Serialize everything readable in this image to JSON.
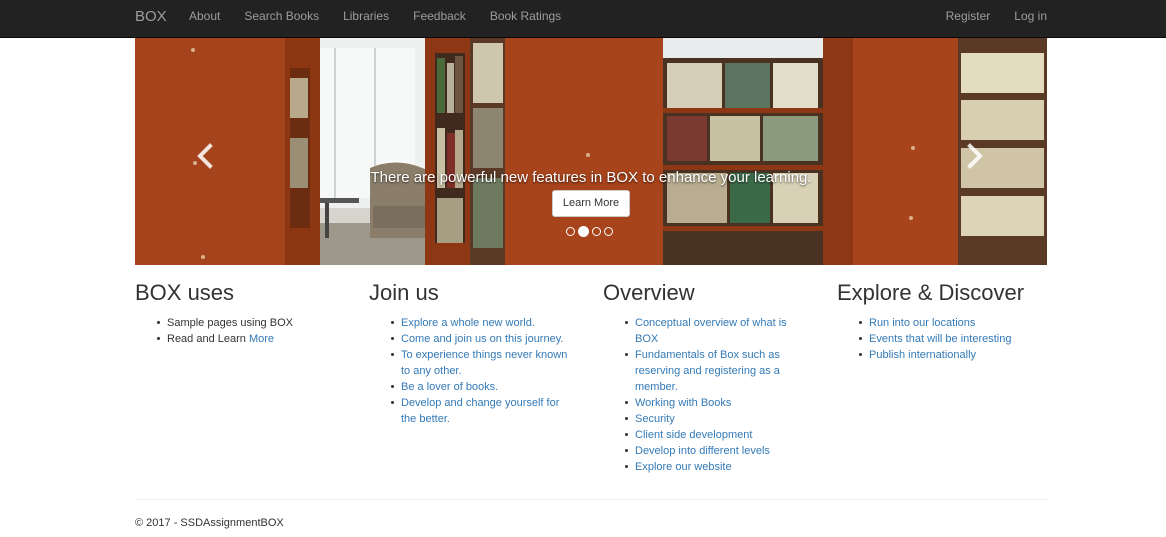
{
  "navbar": {
    "brand": "BOX",
    "links": [
      "About",
      "Search Books",
      "Libraries",
      "Feedback",
      "Book Ratings"
    ],
    "right_links": [
      "Register",
      "Log in"
    ]
  },
  "carousel": {
    "caption": "There are powerful new features in BOX to enhance your learning.",
    "button_label": "Learn More",
    "slide_count": 4,
    "active_slide": 2,
    "prev_icon": "chevron-left-icon",
    "next_icon": "chevron-right-icon"
  },
  "columns": [
    {
      "heading": "BOX uses",
      "items": [
        {
          "text": "Sample pages using BOX"
        },
        {
          "text": "Read and Learn ",
          "link": "More"
        }
      ]
    },
    {
      "heading": "Join us",
      "items": [
        {
          "link": "Explore a whole new world."
        },
        {
          "link": "Come and join us on this journey."
        },
        {
          "link": "To experience things never known to any other."
        },
        {
          "link": "Be a lover of books."
        },
        {
          "link": "Develop and change yourself for the better."
        }
      ]
    },
    {
      "heading": "Overview",
      "items": [
        {
          "link": "Conceptual overview of what is BOX"
        },
        {
          "link": "Fundamentals of Box such as reserving and registering as a member."
        },
        {
          "link": "Working with Books"
        },
        {
          "link": "Security"
        },
        {
          "link": "Client side development"
        },
        {
          "link": "Develop into different levels"
        },
        {
          "link": "Explore our website"
        }
      ]
    },
    {
      "heading": "Explore & Discover",
      "items": [
        {
          "link": "Run into our locations"
        },
        {
          "link": "Events that will be interesting"
        },
        {
          "link": "Publish internationally"
        }
      ]
    }
  ],
  "footer": {
    "text": "© 2017 - SSDAssignmentBOX"
  },
  "colors": {
    "navbar_bg": "#222222",
    "nav_text": "#9d9d9d",
    "link": "#337ab7"
  }
}
